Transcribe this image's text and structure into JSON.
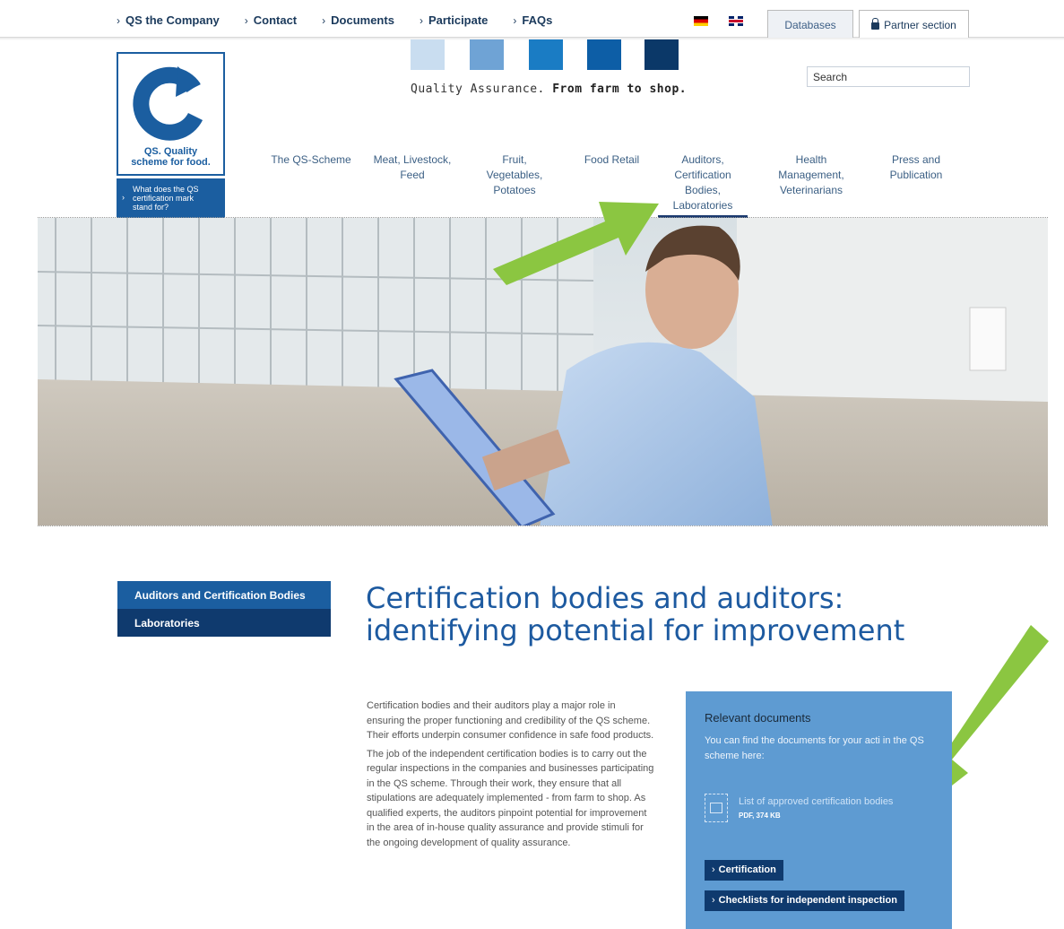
{
  "topnav": {
    "links": [
      "QS the Company",
      "Contact",
      "Documents",
      "Participate",
      "FAQs"
    ],
    "databases_tab": "Databases",
    "partner_tab": "Partner section"
  },
  "logo": {
    "text_line1": "QS. Quality",
    "text_line2": "scheme for food.",
    "sub_line1": "What does the QS",
    "sub_line2": "certification mark",
    "sub_line3": "stand for?"
  },
  "header": {
    "tagline_prefix": "Quality Assurance.",
    "tagline_bold": "From farm to shop.",
    "search_placeholder": "Search",
    "colors": [
      "#c9ddf0",
      "#6fa3d5",
      "#1a7cc4",
      "#0d5ea6",
      "#0b3868"
    ]
  },
  "mainnav": {
    "items": [
      [
        "The QS-Scheme"
      ],
      [
        "Meat, Livestock,",
        "Feed"
      ],
      [
        "Fruit,",
        "Vegetables,",
        "Potatoes"
      ],
      [
        "Food Retail"
      ],
      [
        "Auditors,",
        "Certification",
        "Bodies,",
        "Laboratories"
      ],
      [
        "Health",
        "Management,",
        "Veterinarians"
      ],
      [
        "Press and",
        "Publication"
      ]
    ],
    "active_index": 4
  },
  "sidebar": {
    "items": [
      "Auditors and Certification Bodies",
      "Laboratories"
    ]
  },
  "main": {
    "title_line1": "Certification bodies and auditors:",
    "title_line2": "identifying potential for improvement",
    "para1": "Certification bodies and their auditors play a major role in ensuring the proper functioning and credibility of the QS scheme. Their efforts underpin consumer confidence in safe food products.",
    "para2": "The job of the independent certification bodies is to carry out the regular inspections in the companies and businesses participating in the QS scheme. Through their work, they ensure that all stipulations are adequately implemented - from farm to shop. As qualified experts, the auditors pinpoint potential for improvement in the area of in-house quality assurance and provide stimuli for the ongoing development of quality assurance."
  },
  "docs_box": {
    "heading": "Relevant documents",
    "intro": "You can find the documents for your acti in the QS scheme here:",
    "doc_link": "List of approved certification bodies",
    "doc_meta": "PDF, 374 KB",
    "buttons": [
      "Certification",
      "Checklists for independent inspection"
    ]
  },
  "annotation_color": "#8bc641"
}
